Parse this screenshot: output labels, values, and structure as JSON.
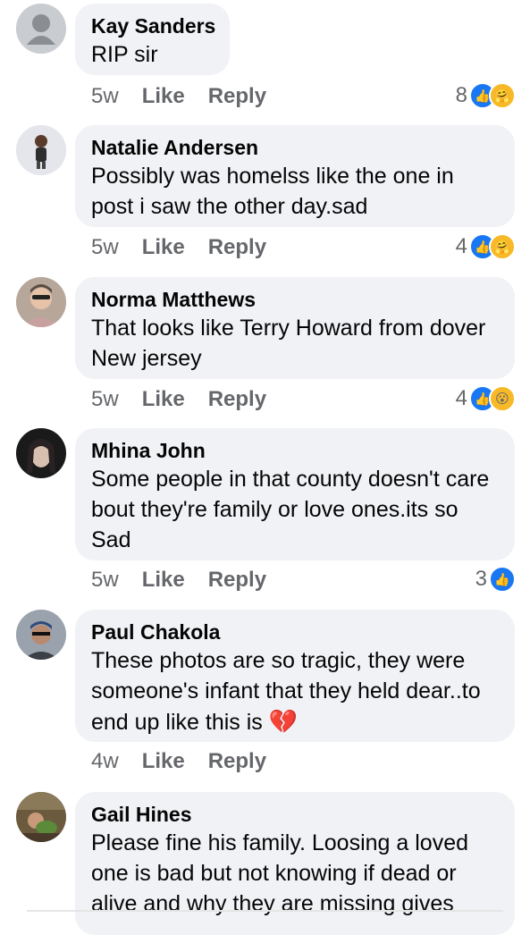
{
  "comments": [
    {
      "name": "Kay Sanders",
      "text": "RIP sir",
      "time": "5w",
      "like": "Like",
      "reply": "Reply",
      "reaction_count": "8",
      "reactions": [
        "like-icon",
        "care-icon"
      ]
    },
    {
      "name": "Natalie Andersen",
      "text": "Possibly was homelss like the one in post i saw the other day.sad",
      "time": "5w",
      "like": "Like",
      "reply": "Reply",
      "reaction_count": "4",
      "reactions": [
        "like-icon",
        "care-icon"
      ]
    },
    {
      "name": "Norma Matthews",
      "text": "That looks like Terry Howard from dover New jersey",
      "time": "5w",
      "like": "Like",
      "reply": "Reply",
      "reaction_count": "4",
      "reactions": [
        "like-icon",
        "wow-icon"
      ]
    },
    {
      "name": "Mhina John",
      "text": "Some people in that county doesn't care bout they're family or love ones.its so Sad",
      "time": "5w",
      "like": "Like",
      "reply": "Reply",
      "reaction_count": "3",
      "reactions": [
        "like-icon"
      ]
    },
    {
      "name": "Paul Chakola",
      "text": "These photos are so tragic, they were someone's infant that they held dear..to end up like this is",
      "time": "4w",
      "like": "Like",
      "reply": "Reply",
      "emoji": "broken-heart-icon"
    },
    {
      "name": "Gail Hines",
      "text": "Please fine his family. Loosing a loved one is bad but not knowing if dead or alive and why they are missing gives"
    }
  ]
}
